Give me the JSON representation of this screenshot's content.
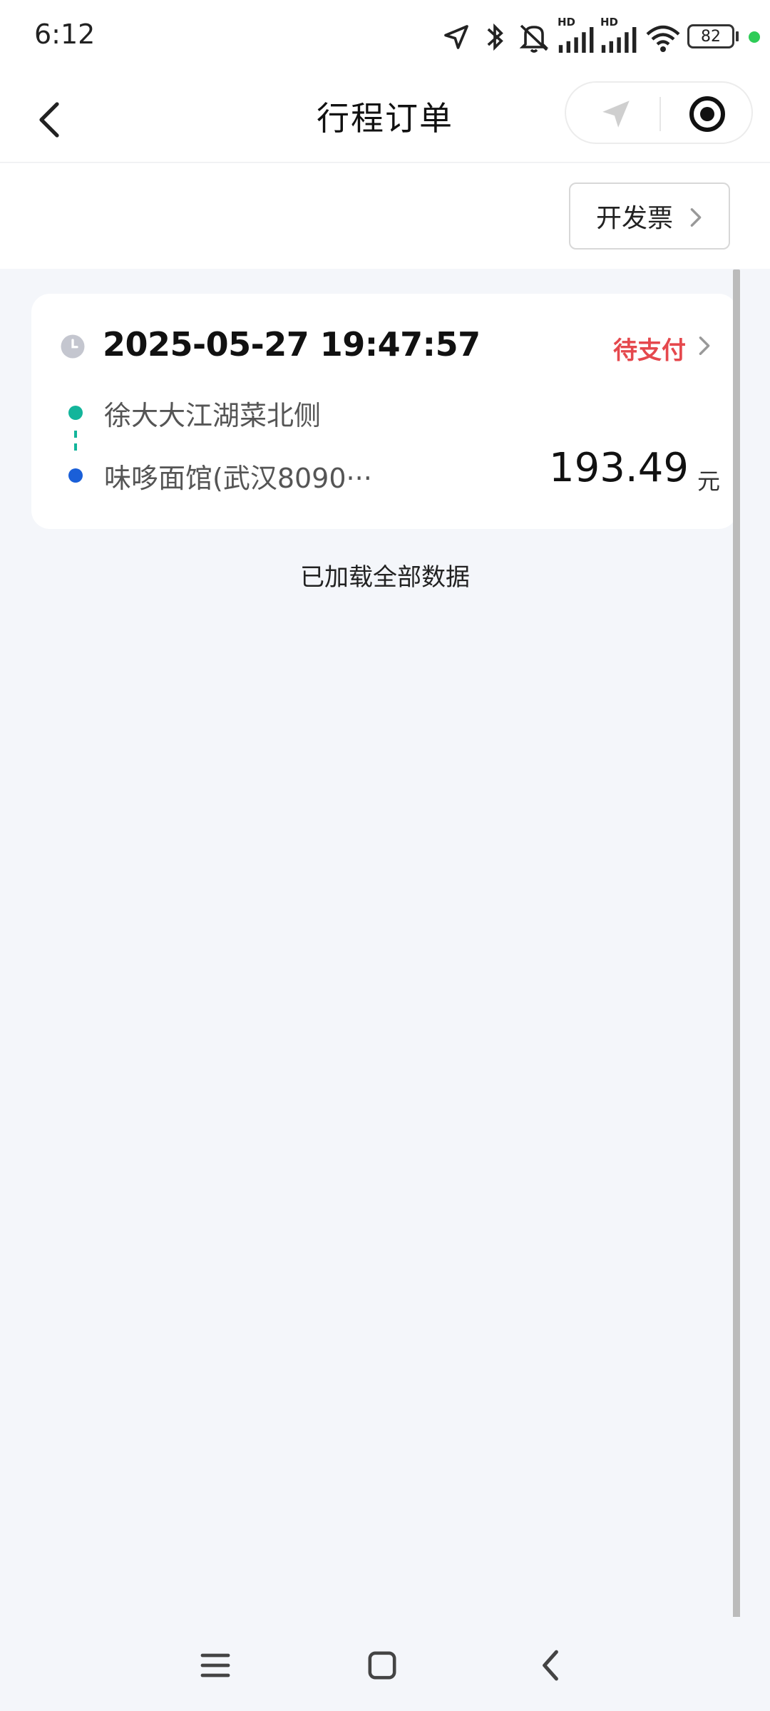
{
  "status_bar": {
    "time": "6:12",
    "battery": "82",
    "hd_1": "HD",
    "hd_2": "HD",
    "icons": [
      "location-arrow-icon",
      "bluetooth-icon",
      "mute-icon",
      "signal-icon",
      "signal-icon",
      "wifi-icon",
      "battery-icon"
    ]
  },
  "header": {
    "title": "行程订单"
  },
  "invoice": {
    "label": "开发票"
  },
  "order": {
    "time": "2025-05-27 19:47:57",
    "status": "待支付",
    "start": "徐大大江湖菜北侧",
    "end": "味哆面馆(武汉8090···",
    "price": "193.49",
    "unit": "元"
  },
  "list_footer": "已加载全部数据",
  "colors": {
    "status_red": "#e5484d",
    "start_green": "#13b59b",
    "end_blue": "#1a5fd8"
  }
}
